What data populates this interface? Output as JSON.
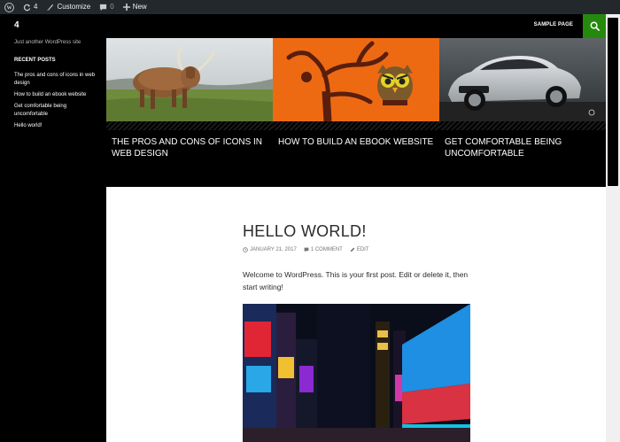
{
  "adminbar": {
    "comments_count_updates": "4",
    "customize_label": "Customize",
    "comments_count": "0",
    "new_label": "New"
  },
  "header": {
    "site_title": "4",
    "menu_item": "SAMPLE PAGE",
    "accent": "#24890d"
  },
  "sidebar": {
    "tagline": "Just another WordPress site",
    "widget_title": "RECENT POSTS",
    "recent_posts": [
      "The pros and cons of icons in web design",
      "How to build an ebook website",
      "Get comfortable being uncomfortable",
      "Hello world!"
    ]
  },
  "featured": [
    {
      "title": "THE PROS AND CONS OF ICONS IN WEB DESIGN",
      "image": "highland-cow-photo"
    },
    {
      "title": "HOW TO BUILD AN EBOOK WEBSITE",
      "image": "owl-illustration"
    },
    {
      "title": "GET COMFORTABLE BEING UNCOMFORTABLE",
      "image": "silver-car-photo"
    }
  ],
  "post": {
    "title": "HELLO WORLD!",
    "date": "JANUARY 21, 2017",
    "comments": "1 COMMENT",
    "edit": "EDIT",
    "excerpt": "Welcome to WordPress. This is your first post. Edit or delete it, then start writing!",
    "image": "times-square-night-photo"
  }
}
